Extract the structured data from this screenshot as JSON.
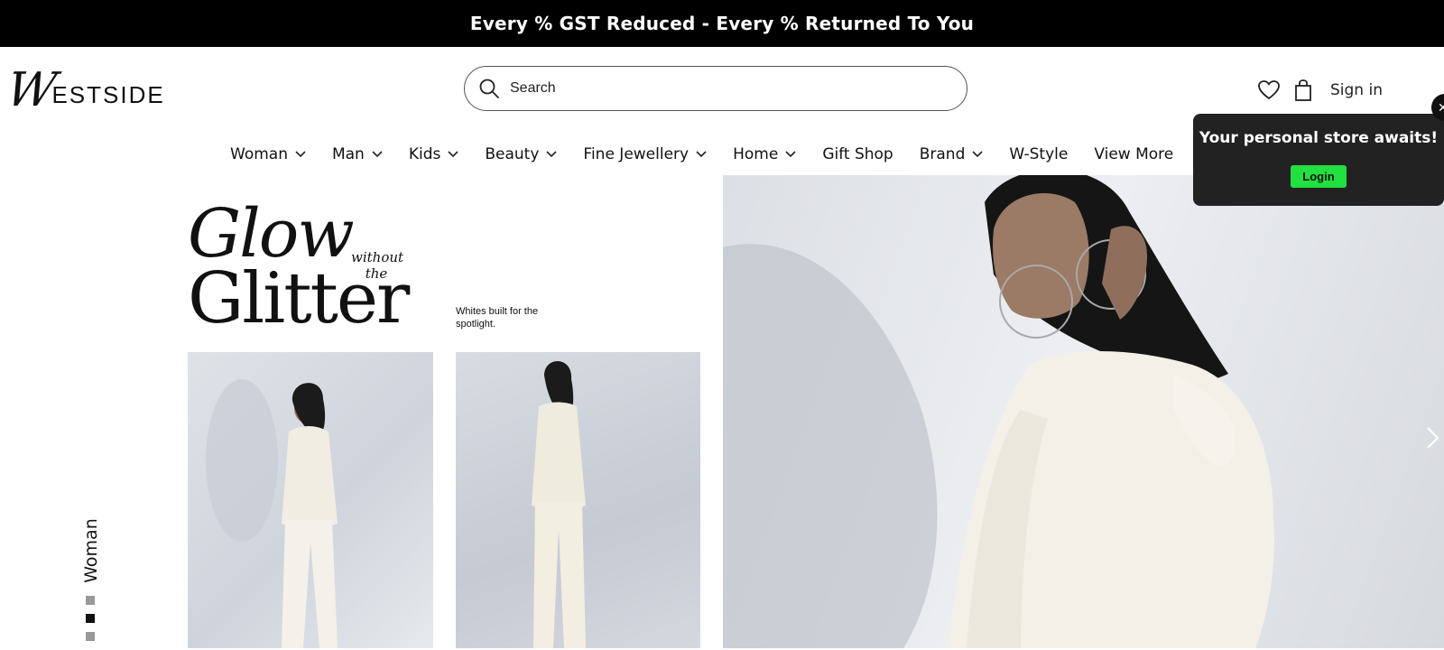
{
  "promo": {
    "text": "Every % GST Reduced - Every % Returned To You"
  },
  "header": {
    "logo": {
      "first": "W",
      "rest": "ESTSIDE"
    },
    "search": {
      "placeholder": "Search"
    },
    "wishlist_icon": "heart-icon",
    "bag_icon": "shopping-bag-icon",
    "signin_label": "Sign in"
  },
  "nav": {
    "items": [
      {
        "label": "Woman",
        "has_dropdown": true
      },
      {
        "label": "Man",
        "has_dropdown": true
      },
      {
        "label": "Kids",
        "has_dropdown": true
      },
      {
        "label": "Beauty",
        "has_dropdown": true
      },
      {
        "label": "Fine Jewellery",
        "has_dropdown": true
      },
      {
        "label": "Home",
        "has_dropdown": true
      },
      {
        "label": "Gift Shop",
        "has_dropdown": false
      },
      {
        "label": "Brand",
        "has_dropdown": true
      },
      {
        "label": "W-Style",
        "has_dropdown": false
      },
      {
        "label": "View More",
        "has_dropdown": false
      }
    ]
  },
  "popup": {
    "title": "Your personal store awaits!",
    "login_label": "Login",
    "close_icon": "close-icon"
  },
  "hero": {
    "title_line1": "Glow",
    "title_small": "without the",
    "title_line2": "Glitter",
    "subtitle": "Whites built for the spotlight.",
    "side_label": "Woman",
    "next_icon": "chevron-right-icon"
  },
  "colors": {
    "promo_bg": "#000000",
    "login_button": "#22e040",
    "popup_bg": "#222222"
  }
}
